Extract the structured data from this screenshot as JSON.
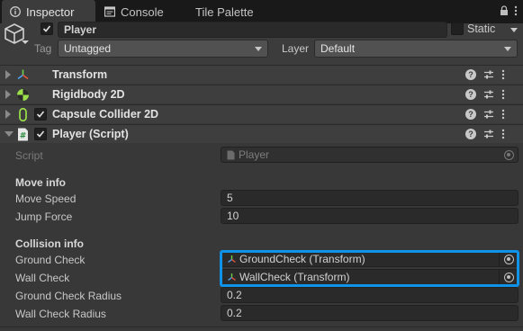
{
  "tabs": [
    {
      "label": "Inspector",
      "icon": "info-icon"
    },
    {
      "label": "Console",
      "icon": "console-icon"
    },
    {
      "label": "Tile Palette",
      "icon": ""
    }
  ],
  "header": {
    "object_name": "Player",
    "static_label": "Static",
    "tag_label": "Tag",
    "tag_value": "Untagged",
    "layer_label": "Layer",
    "layer_value": "Default"
  },
  "components": [
    {
      "name": "Transform",
      "icon": "transform-icon",
      "has_checkbox": false
    },
    {
      "name": "Rigidbody 2D",
      "icon": "rigidbody2d-icon",
      "has_checkbox": false
    },
    {
      "name": "Capsule Collider 2D",
      "icon": "capsule-collider-icon",
      "has_checkbox": true
    },
    {
      "name": "Player (Script)",
      "icon": "script-icon",
      "has_checkbox": true
    }
  ],
  "script": {
    "script_label": "Script",
    "script_value": "Player",
    "move_info_title": "Move info",
    "move_speed_label": "Move Speed",
    "move_speed_value": "5",
    "jump_force_label": "Jump Force",
    "jump_force_value": "10",
    "collision_info_title": "Collision info",
    "ground_check_label": "Ground Check",
    "ground_check_value": "GroundCheck (Transform)",
    "wall_check_label": "Wall Check",
    "wall_check_value": "WallCheck (Transform)",
    "ground_check_radius_label": "Ground Check Radius",
    "ground_check_radius_value": "0.2",
    "wall_check_radius_label": "Wall Check Radius",
    "wall_check_radius_value": "0.2"
  },
  "colors": {
    "highlight": "#0e93e8",
    "background": "#383838",
    "tab_bar": "#191919"
  }
}
